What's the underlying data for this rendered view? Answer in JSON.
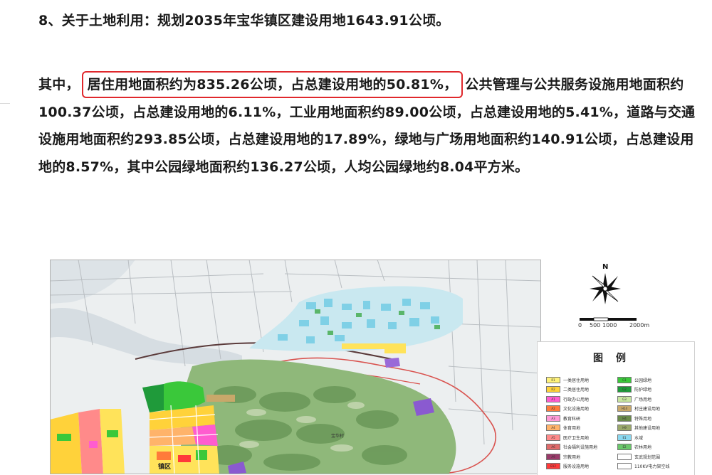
{
  "paragraphs": {
    "heading": "8、关于土地利用：规划2035年宝华镇区建设用地1643.91公顷。",
    "body_prefix": "其中，",
    "body_highlight": "居住用地面积约为835.26公顷，占总建设用地的50.81%，",
    "body_rest": "公共管理与公共服务设施用地面积约100.37公顷，占总建设用地的6.11%，工业用地面积约89.00公顷，占总建设用地的5.41%，道路与交通设施用地面积约293.85公顷，占总建设用地的17.89%，绿地与广场用地面积约140.91公顷，占总建设用地的8.57%，其中公园绿地面积约136.27公顷，人均公园绿地约8.04平方米。"
  },
  "map": {
    "north_label": "N",
    "scale_labels": [
      "0",
      "500",
      "1000",
      "2000m"
    ],
    "place_labels": [
      "宝华村",
      "镇区"
    ],
    "legend": {
      "title": "图例",
      "items_left": [
        {
          "code": "R1",
          "label": "一类居住用地",
          "color": "#fff27a"
        },
        {
          "code": "R2",
          "label": "二类居住用地",
          "color": "#ffd23a"
        },
        {
          "code": "A1",
          "label": "行政办公用地",
          "color": "#ff5ccf"
        },
        {
          "code": "A2",
          "label": "文化设施用地",
          "color": "#ff7a3a"
        },
        {
          "code": "A3",
          "label": "教育科研",
          "color": "#ff9ad6"
        },
        {
          "code": "A4",
          "label": "体育用地",
          "color": "#ffb36a"
        },
        {
          "code": "A5",
          "label": "医疗卫生用地",
          "color": "#ff8a8a"
        },
        {
          "code": "A6",
          "label": "社会福利设施用地",
          "color": "#e06a6a"
        },
        {
          "code": "A9",
          "label": "宗教用地",
          "color": "#9a3a6a"
        },
        {
          "code": "B12",
          "label": "服务设施用地",
          "color": "#ff3a3a"
        }
      ],
      "items_right": [
        {
          "code": "G1",
          "label": "公园绿地",
          "color": "#3ac83a"
        },
        {
          "code": "G2",
          "label": "防护绿地",
          "color": "#1f9a3a"
        },
        {
          "code": "G3",
          "label": "广场用地",
          "color": "#c8e6a0"
        },
        {
          "code": "H14",
          "label": "村庄建设用地",
          "color": "#c8a86a"
        },
        {
          "code": "H4",
          "label": "特殊用地",
          "color": "#6a8a4a"
        },
        {
          "code": "H9",
          "label": "其他建设用地",
          "color": "#9aa86a"
        },
        {
          "code": "E1",
          "label": "水域",
          "color": "#8ad8f0"
        },
        {
          "code": "E2",
          "label": "农林用地",
          "color": "#6ac86a"
        },
        {
          "code": "",
          "label": "玄武规划范围",
          "color": "#ffffff"
        },
        {
          "code": "",
          "label": "110KV电力架空线",
          "color": "#ffffff"
        }
      ]
    }
  },
  "colors": {
    "highlight_border": "#e0282c",
    "text": "#1a1a1a"
  }
}
